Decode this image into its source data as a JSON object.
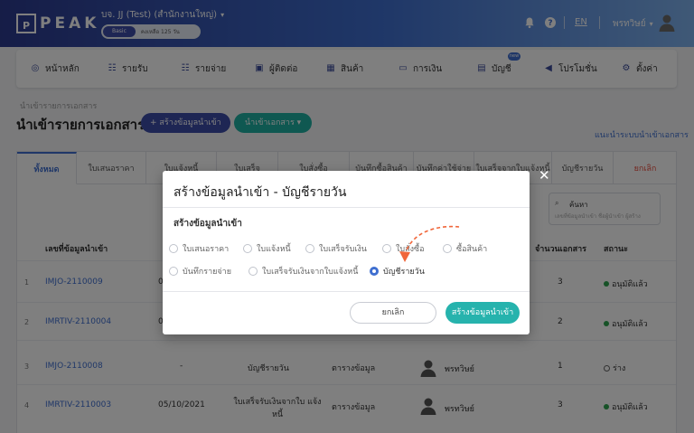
{
  "header": {
    "logo_mark": "P",
    "logo_text": "PEAK",
    "company": "บจ. JJ (Test) (สำนักงานใหญ่)",
    "plan_label": "Basic",
    "plan_remaining": "คงเหลือ 125 วัน",
    "language": "EN",
    "user_name": "พรทวิษย์"
  },
  "nav": {
    "items": [
      {
        "label": "หน้าหลัก",
        "icon": "dashboard-icon"
      },
      {
        "label": "รายรับ",
        "icon": "income-icon"
      },
      {
        "label": "รายจ่าย",
        "icon": "expense-icon"
      },
      {
        "label": "ผู้ติดต่อ",
        "icon": "contacts-icon"
      },
      {
        "label": "สินค้า",
        "icon": "product-icon"
      },
      {
        "label": "การเงิน",
        "icon": "finance-icon"
      },
      {
        "label": "บัญชี",
        "icon": "accounting-icon"
      },
      {
        "label": "โปรโมชั่น",
        "icon": "promotion-icon"
      },
      {
        "label": "ตั้งค่า",
        "icon": "settings-icon"
      }
    ],
    "new_badge": "new"
  },
  "page": {
    "breadcrumb": "นำเข้ารายการเอกสาร",
    "title": "นำเข้ารายการเอกสาร",
    "create_button": "สร้างข้อมูลนำเข้า",
    "import_button": "นำเข้าเอกสาร",
    "support_link": "แนะนำระบบนำเข้าเอกสาร"
  },
  "tabs": [
    "ทั้งหมด",
    "ใบเสนอราคา",
    "ใบแจ้งหนี้",
    "ใบเสร็จ",
    "ใบสั่งซื้อ",
    "บันทึกซื้อสินค้า",
    "บันทึกค่าใช้จ่าย",
    "ใบเสร็จจากใบแจ้งหนี้",
    "บัญชีรายวัน",
    "ยกเลิก"
  ],
  "search": {
    "label": "ค้นหา",
    "placeholder": "เลขที่ข้อมูลนำเข้า ชื่อผู้นำเข้า ผู้สร้าง"
  },
  "table": {
    "columns": [
      "เลขที่ข้อมูลนำเข้า",
      "จำนวนเอกสาร",
      "สถานะ"
    ],
    "rows": [
      {
        "index": "1",
        "code": "IMJO-2110009",
        "date": "0",
        "doc_type": "",
        "source": "",
        "user": "",
        "count": "3",
        "status": "อนุมัติแล้ว",
        "status_kind": "approved"
      },
      {
        "index": "2",
        "code": "IMRTIV-2110004",
        "date": "0",
        "doc_type": "",
        "source": "",
        "user": "",
        "count": "2",
        "status": "อนุมัติแล้ว",
        "status_kind": "approved"
      },
      {
        "index": "3",
        "code": "IMJO-2110008",
        "date": "-",
        "doc_type": "บัญชีรายวัน",
        "source": "ตารางข้อมูล",
        "user": "พรทวิษย์",
        "count": "1",
        "status": "ร่าง",
        "status_kind": "draft"
      },
      {
        "index": "4",
        "code": "IMRTIV-2110003",
        "date": "05/10/2021",
        "doc_type": "ใบเสร็จรับเงินจากใบ แจ้งหนี้",
        "source": "ตารางข้อมูล",
        "user": "พรทวิษย์",
        "count": "3",
        "status": "อนุมัติแล้ว",
        "status_kind": "approved"
      }
    ]
  },
  "modal": {
    "title": "สร้างข้อมูลนำเข้า - บัญชีรายวัน",
    "subtitle": "สร้างข้อมูลนำเข้า",
    "options": [
      "ใบเสนอราคา",
      "ใบแจ้งหนี้",
      "ใบเสร็จรับเงิน",
      "ใบสั่งซื้อ",
      "ซื้อสินค้า",
      "บันทึกรายจ่าย",
      "ใบเสร็จรับเงินจากใบแจ้งหนี้",
      "บัญชีรายวัน"
    ],
    "selected_option": "บัญชีรายวัน",
    "cancel_button": "ยกเลิก",
    "submit_button": "สร้างข้อมูลนำเข้า",
    "close_icon": "close-icon"
  },
  "colors": {
    "brand": "#3d4ca8",
    "accent": "#26b3ad",
    "link": "#3f6fd0",
    "approved": "#2ea44f",
    "cancel_tab": "#e84b3c",
    "hint_arrow": "#f0663a"
  }
}
